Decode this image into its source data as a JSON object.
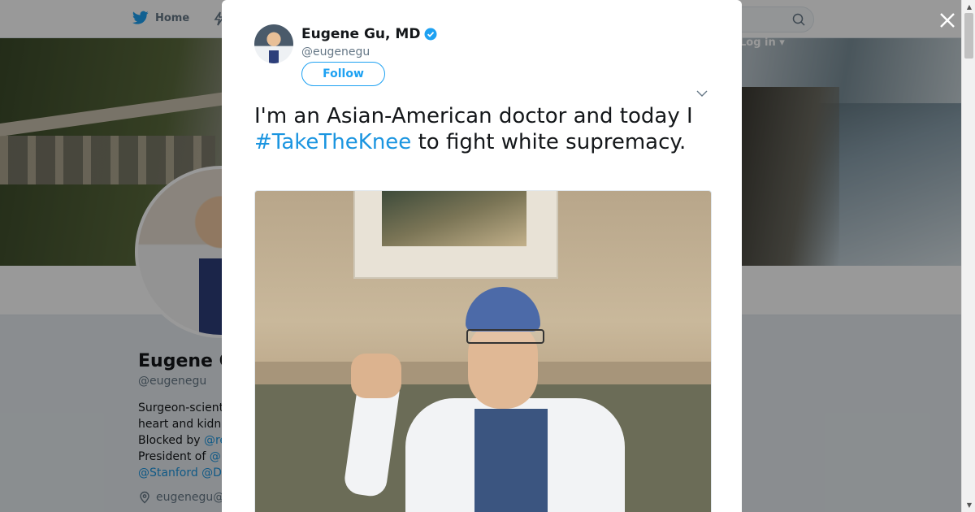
{
  "nav": {
    "home_label": "Home",
    "login_label": "Log in"
  },
  "profile": {
    "name": "Eugene G",
    "handle": "@eugenegu",
    "bio_lines": [
      {
        "text": "Surgeon-scient"
      },
      {
        "text": "heart and kidn"
      },
      {
        "text": "Blocked by ",
        "link": "@re"
      },
      {
        "text": "President of ",
        "link": "@"
      },
      {
        "text": "",
        "link": "@Stanford @D"
      }
    ],
    "location": "eugenegu@"
  },
  "tweet": {
    "author_name": "Eugene Gu, MD",
    "author_handle": "@eugenegu",
    "follow_label": "Follow",
    "text_before": "I'm an Asian-American doctor and today I ",
    "hashtag": "#TakeTheKnee",
    "text_after": " to fight white supremacy."
  },
  "colors": {
    "accent": "#1da1f2",
    "link": "#1b95e0",
    "verified": "#1da1f2"
  },
  "icons": [
    "twitter-bird-icon",
    "lightning-icon",
    "search-icon",
    "close-icon",
    "verified-badge-icon",
    "chevron-down-icon",
    "location-pin-icon"
  ]
}
